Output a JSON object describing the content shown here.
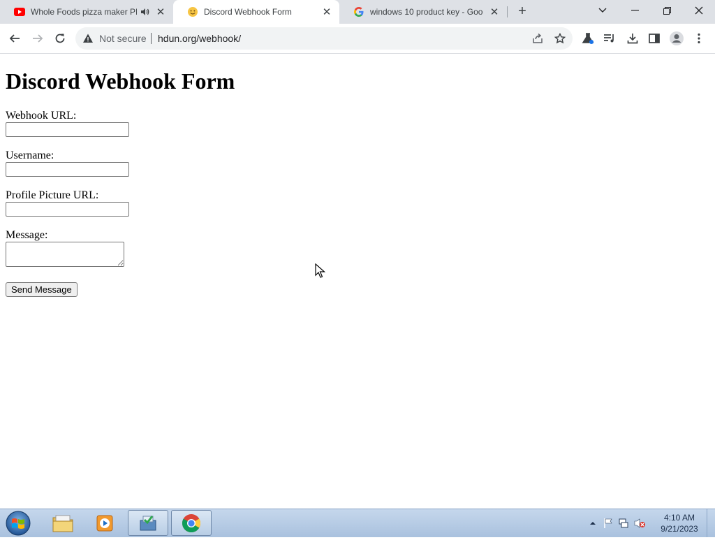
{
  "browser": {
    "tabs": [
      {
        "title": "Whole Foods pizza maker PI",
        "favicon": "youtube-icon",
        "audio": true,
        "active": false
      },
      {
        "title": "Discord Webhook Form",
        "favicon": "smiley-icon",
        "audio": false,
        "active": true
      },
      {
        "title": "windows 10 product key - Goog",
        "favicon": "google-icon",
        "audio": false,
        "active": false
      }
    ],
    "security_label": "Not secure",
    "url": "hdun.org/webhook/"
  },
  "page": {
    "heading": "Discord Webhook Form",
    "fields": [
      {
        "label": "Webhook URL:",
        "value": ""
      },
      {
        "label": "Username:",
        "value": ""
      },
      {
        "label": "Profile Picture URL:",
        "value": ""
      }
    ],
    "message": {
      "label": "Message:",
      "value": ""
    },
    "submit_label": "Send Message"
  },
  "taskbar": {
    "apps": [
      "file-explorer-icon",
      "media-player-icon",
      "installer-icon",
      "chrome-icon"
    ],
    "time": "4:10 AM",
    "date": "9/21/2023"
  },
  "colors": {
    "tabstrip": "#dee1e6",
    "omnibox": "#f1f3f4",
    "taskbar": "#b6cbe4"
  }
}
